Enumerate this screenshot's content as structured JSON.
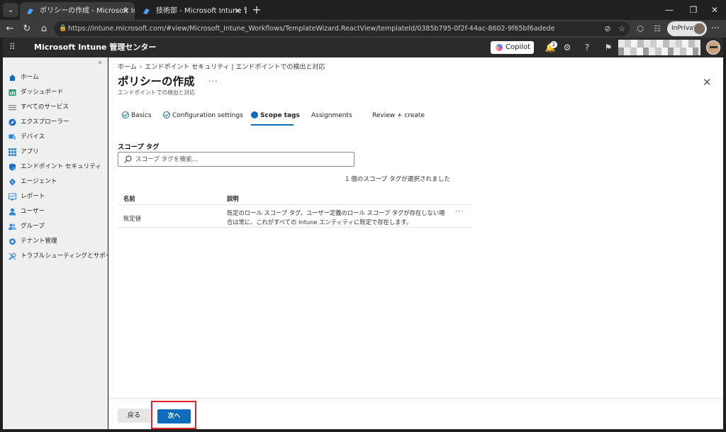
{
  "browser": {
    "tabs": [
      {
        "title": "ポリシーの作成 - Microsoft Intune 管",
        "active": true
      },
      {
        "title": "技術部 - Microsoft Intune 管理セン",
        "active": false
      }
    ],
    "url": "https://intune.microsoft.com/#view/Microsoft_Intune_Workflows/TemplateWizard.ReactView/templateId/0385b795-0f2f-44ac-8602-9f65bf6adede",
    "inprivate_label": "InPrivate"
  },
  "header": {
    "app_title": "Microsoft Intune 管理センター",
    "copilot_label": "Copilot",
    "notification_count": "2"
  },
  "sidebar": {
    "items": [
      {
        "label": "ホーム",
        "icon": "home-icon"
      },
      {
        "label": "ダッシュボード",
        "icon": "dashboard-icon"
      },
      {
        "label": "すべてのサービス",
        "icon": "list-icon"
      },
      {
        "label": "エクスプローラー",
        "icon": "explorer-icon"
      },
      {
        "label": "デバイス",
        "icon": "devices-icon"
      },
      {
        "label": "アプリ",
        "icon": "apps-icon"
      },
      {
        "label": "エンドポイント セキュリティ",
        "icon": "shield-icon"
      },
      {
        "label": "エージェント",
        "icon": "agent-icon"
      },
      {
        "label": "レポート",
        "icon": "reports-icon"
      },
      {
        "label": "ユーザー",
        "icon": "user-icon"
      },
      {
        "label": "グループ",
        "icon": "group-icon"
      },
      {
        "label": "テナント管理",
        "icon": "tenant-icon"
      },
      {
        "label": "トラブルシューティングとサポート",
        "icon": "wrench-icon"
      }
    ]
  },
  "breadcrumb": [
    "ホーム",
    "エンドポイント セキュリティ | エンドポイントでの検出と対応"
  ],
  "page": {
    "title": "ポリシーの作成",
    "more": "···",
    "subtitle": "エンドポイントでの検出と対応"
  },
  "steps": [
    {
      "label": "Basics",
      "state": "done"
    },
    {
      "label": "Configuration settings",
      "state": "done"
    },
    {
      "label": "Scope tags",
      "state": "current"
    },
    {
      "label": "Assignments",
      "state": "pending"
    },
    {
      "label": "Review + create",
      "state": "pending"
    }
  ],
  "scope": {
    "section_label": "スコープ タグ",
    "search_placeholder": "スコープ タグを検索...",
    "selected_text": "1 個のスコープ タグが選択されました",
    "columns": [
      "名前",
      "説明"
    ],
    "rows": [
      {
        "name": "既定値",
        "description": "既定のロール スコープ タグ。ユーザー定義のロール スコープ タグが存在しない場合は常に、これがすべての Intune エンティティに既定で存在します。"
      }
    ]
  },
  "footer": {
    "back_label": "戻る",
    "next_label": "次へ"
  },
  "colors": {
    "accent": "#0f6cbd",
    "highlight": "#e0242c"
  }
}
